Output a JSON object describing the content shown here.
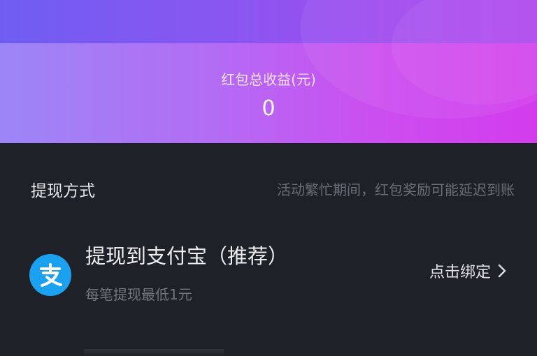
{
  "earnings": {
    "label": "红包总收益(元)",
    "value": "0"
  },
  "withdraw": {
    "title": "提现方式",
    "notice": "活动繁忙期间，红包奖励可能延迟到账"
  },
  "alipay": {
    "title": "提现到支付宝（推荐）",
    "subtitle": "每笔提现最低1元",
    "action_label": "点击绑定",
    "icon": "alipay-icon",
    "icon_color": "#1aa2f0"
  },
  "colors": {
    "background": "#1f2129",
    "gradient_start": "#9c86f6",
    "gradient_end": "#d33cec"
  }
}
